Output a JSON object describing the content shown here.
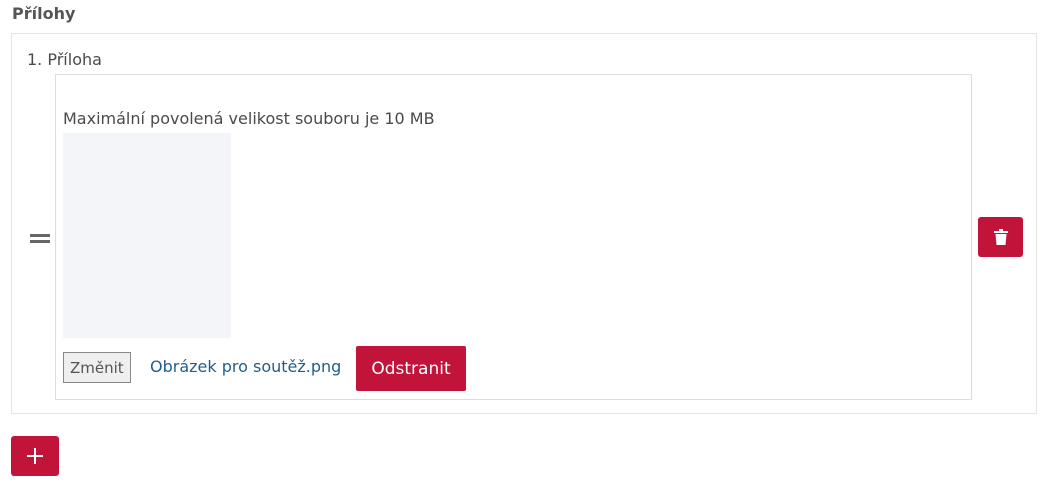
{
  "section": {
    "title": "Přílohy"
  },
  "attachment": {
    "label": "1. Příloha",
    "size_note": "Maximální povolená velikost souboru je 10 MB",
    "change_label": "Změnit",
    "file_name": "Obrázek pro soutěž.png",
    "remove_label": "Odstranit"
  },
  "icons": {
    "drag": "drag-handle-icon",
    "delete": "trash-icon",
    "add": "plus-icon"
  },
  "colors": {
    "accent": "#c2133b",
    "link": "#1f5f8b",
    "preview_bg": "#f4f5f8"
  }
}
